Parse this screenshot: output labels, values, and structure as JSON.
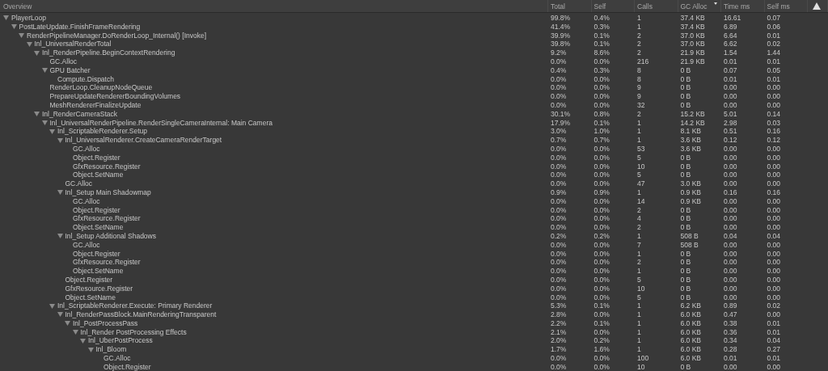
{
  "columns": [
    {
      "label": "Overview"
    },
    {
      "label": "Total"
    },
    {
      "label": "Self"
    },
    {
      "label": "Calls"
    },
    {
      "label": "GC Alloc",
      "sorted": true
    },
    {
      "label": "Time ms"
    },
    {
      "label": "Self ms"
    }
  ],
  "rows": [
    {
      "name": "PlayerLoop",
      "expanded": true,
      "cells": [
        "99.8%",
        "0.4%",
        "1",
        "37.4 KB",
        "16.61",
        "0.07"
      ],
      "children": [
        {
          "name": "PostLateUpdate.FinishFrameRendering",
          "expanded": true,
          "cells": [
            "41.4%",
            "0.3%",
            "1",
            "37.4 KB",
            "6.89",
            "0.06"
          ],
          "children": [
            {
              "name": "RenderPipelineManager.DoRenderLoop_Internal() [Invoke]",
              "expanded": true,
              "cells": [
                "39.9%",
                "0.1%",
                "2",
                "37.0 KB",
                "6.64",
                "0.01"
              ],
              "children": [
                {
                  "name": "Inl_UniversalRenderTotal",
                  "expanded": true,
                  "cells": [
                    "39.8%",
                    "0.1%",
                    "2",
                    "37.0 KB",
                    "6.62",
                    "0.02"
                  ],
                  "children": [
                    {
                      "name": "Inl_RenderPipeline.BeginContextRendering",
                      "expanded": true,
                      "cells": [
                        "9.2%",
                        "8.6%",
                        "2",
                        "21.9 KB",
                        "1.54",
                        "1.44"
                      ],
                      "children": [
                        {
                          "name": "GC.Alloc",
                          "cells": [
                            "0.0%",
                            "0.0%",
                            "216",
                            "21.9 KB",
                            "0.01",
                            "0.01"
                          ]
                        },
                        {
                          "name": "GPU Batcher",
                          "expanded": true,
                          "cells": [
                            "0.4%",
                            "0.3%",
                            "8",
                            "0 B",
                            "0.07",
                            "0.05"
                          ],
                          "children": [
                            {
                              "name": "Compute.Dispatch",
                              "cells": [
                                "0.0%",
                                "0.0%",
                                "8",
                                "0 B",
                                "0.01",
                                "0.01"
                              ]
                            }
                          ]
                        },
                        {
                          "name": "RenderLoop.CleanupNodeQueue",
                          "cells": [
                            "0.0%",
                            "0.0%",
                            "9",
                            "0 B",
                            "0.00",
                            "0.00"
                          ]
                        },
                        {
                          "name": "PrepareUpdateRendererBoundingVolumes",
                          "cells": [
                            "0.0%",
                            "0.0%",
                            "9",
                            "0 B",
                            "0.00",
                            "0.00"
                          ]
                        },
                        {
                          "name": "MeshRendererFinalizeUpdate",
                          "cells": [
                            "0.0%",
                            "0.0%",
                            "32",
                            "0 B",
                            "0.00",
                            "0.00"
                          ]
                        }
                      ]
                    },
                    {
                      "name": "Inl_RenderCameraStack",
                      "expanded": true,
                      "cells": [
                        "30.1%",
                        "0.8%",
                        "2",
                        "15.2 KB",
                        "5.01",
                        "0.14"
                      ],
                      "children": [
                        {
                          "name": "Inl_UniversalRenderPipeline.RenderSingleCameraInternal: Main Camera",
                          "expanded": true,
                          "cells": [
                            "17.9%",
                            "0.1%",
                            "1",
                            "14.2 KB",
                            "2.98",
                            "0.03"
                          ],
                          "children": [
                            {
                              "name": "Inl_ScriptableRenderer.Setup",
                              "expanded": true,
                              "cells": [
                                "3.0%",
                                "1.0%",
                                "1",
                                "8.1 KB",
                                "0.51",
                                "0.16"
                              ],
                              "children": [
                                {
                                  "name": "Inl_UniversalRenderer.CreateCameraRenderTarget",
                                  "expanded": true,
                                  "cells": [
                                    "0.7%",
                                    "0.7%",
                                    "1",
                                    "3.6 KB",
                                    "0.12",
                                    "0.12"
                                  ],
                                  "children": [
                                    {
                                      "name": "GC.Alloc",
                                      "cells": [
                                        "0.0%",
                                        "0.0%",
                                        "53",
                                        "3.6 KB",
                                        "0.00",
                                        "0.00"
                                      ]
                                    },
                                    {
                                      "name": "Object.Register",
                                      "cells": [
                                        "0.0%",
                                        "0.0%",
                                        "5",
                                        "0 B",
                                        "0.00",
                                        "0.00"
                                      ]
                                    },
                                    {
                                      "name": "GfxResource.Register",
                                      "cells": [
                                        "0.0%",
                                        "0.0%",
                                        "10",
                                        "0 B",
                                        "0.00",
                                        "0.00"
                                      ]
                                    },
                                    {
                                      "name": "Object.SetName",
                                      "cells": [
                                        "0.0%",
                                        "0.0%",
                                        "5",
                                        "0 B",
                                        "0.00",
                                        "0.00"
                                      ]
                                    }
                                  ]
                                },
                                {
                                  "name": "GC.Alloc",
                                  "cells": [
                                    "0.0%",
                                    "0.0%",
                                    "47",
                                    "3.0 KB",
                                    "0.00",
                                    "0.00"
                                  ]
                                },
                                {
                                  "name": "Inl_Setup Main Shadowmap",
                                  "expanded": true,
                                  "cells": [
                                    "0.9%",
                                    "0.9%",
                                    "1",
                                    "0.9 KB",
                                    "0.16",
                                    "0.16"
                                  ],
                                  "children": [
                                    {
                                      "name": "GC.Alloc",
                                      "cells": [
                                        "0.0%",
                                        "0.0%",
                                        "14",
                                        "0.9 KB",
                                        "0.00",
                                        "0.00"
                                      ]
                                    },
                                    {
                                      "name": "Object.Register",
                                      "cells": [
                                        "0.0%",
                                        "0.0%",
                                        "2",
                                        "0 B",
                                        "0.00",
                                        "0.00"
                                      ]
                                    },
                                    {
                                      "name": "GfxResource.Register",
                                      "cells": [
                                        "0.0%",
                                        "0.0%",
                                        "4",
                                        "0 B",
                                        "0.00",
                                        "0.00"
                                      ]
                                    },
                                    {
                                      "name": "Object.SetName",
                                      "cells": [
                                        "0.0%",
                                        "0.0%",
                                        "2",
                                        "0 B",
                                        "0.00",
                                        "0.00"
                                      ]
                                    }
                                  ]
                                },
                                {
                                  "name": "Inl_Setup Additional Shadows",
                                  "expanded": true,
                                  "cells": [
                                    "0.2%",
                                    "0.2%",
                                    "1",
                                    "508 B",
                                    "0.04",
                                    "0.04"
                                  ],
                                  "children": [
                                    {
                                      "name": "GC.Alloc",
                                      "cells": [
                                        "0.0%",
                                        "0.0%",
                                        "7",
                                        "508 B",
                                        "0.00",
                                        "0.00"
                                      ]
                                    },
                                    {
                                      "name": "Object.Register",
                                      "cells": [
                                        "0.0%",
                                        "0.0%",
                                        "1",
                                        "0 B",
                                        "0.00",
                                        "0.00"
                                      ]
                                    },
                                    {
                                      "name": "GfxResource.Register",
                                      "cells": [
                                        "0.0%",
                                        "0.0%",
                                        "2",
                                        "0 B",
                                        "0.00",
                                        "0.00"
                                      ]
                                    },
                                    {
                                      "name": "Object.SetName",
                                      "cells": [
                                        "0.0%",
                                        "0.0%",
                                        "1",
                                        "0 B",
                                        "0.00",
                                        "0.00"
                                      ]
                                    }
                                  ]
                                },
                                {
                                  "name": "Object.Register",
                                  "cells": [
                                    "0.0%",
                                    "0.0%",
                                    "5",
                                    "0 B",
                                    "0.00",
                                    "0.00"
                                  ]
                                },
                                {
                                  "name": "GfxResource.Register",
                                  "cells": [
                                    "0.0%",
                                    "0.0%",
                                    "10",
                                    "0 B",
                                    "0.00",
                                    "0.00"
                                  ]
                                },
                                {
                                  "name": "Object.SetName",
                                  "cells": [
                                    "0.0%",
                                    "0.0%",
                                    "5",
                                    "0 B",
                                    "0.00",
                                    "0.00"
                                  ]
                                }
                              ]
                            },
                            {
                              "name": "Inl_ScriptableRenderer.Execute: Primary Renderer",
                              "expanded": true,
                              "cells": [
                                "5.3%",
                                "0.1%",
                                "1",
                                "6.2 KB",
                                "0.89",
                                "0.02"
                              ],
                              "children": [
                                {
                                  "name": "Inl_RenderPassBlock.MainRenderingTransparent",
                                  "expanded": true,
                                  "cells": [
                                    "2.8%",
                                    "0.0%",
                                    "1",
                                    "6.0 KB",
                                    "0.47",
                                    "0.00"
                                  ],
                                  "children": [
                                    {
                                      "name": "Inl_PostProcessPass",
                                      "expanded": true,
                                      "cells": [
                                        "2.2%",
                                        "0.1%",
                                        "1",
                                        "6.0 KB",
                                        "0.38",
                                        "0.01"
                                      ],
                                      "children": [
                                        {
                                          "name": "Inl_Render PostProcessing Effects",
                                          "expanded": true,
                                          "cells": [
                                            "2.1%",
                                            "0.0%",
                                            "1",
                                            "6.0 KB",
                                            "0.36",
                                            "0.01"
                                          ],
                                          "children": [
                                            {
                                              "name": "Inl_UberPostProcess",
                                              "expanded": true,
                                              "cells": [
                                                "2.0%",
                                                "0.2%",
                                                "1",
                                                "6.0 KB",
                                                "0.34",
                                                "0.04"
                                              ],
                                              "children": [
                                                {
                                                  "name": "Inl_Bloom",
                                                  "expanded": true,
                                                  "cells": [
                                                    "1.7%",
                                                    "1.6%",
                                                    "1",
                                                    "6.0 KB",
                                                    "0.28",
                                                    "0.27"
                                                  ],
                                                  "children": [
                                                    {
                                                      "name": "GC.Alloc",
                                                      "cells": [
                                                        "0.0%",
                                                        "0.0%",
                                                        "100",
                                                        "6.0 KB",
                                                        "0.01",
                                                        "0.01"
                                                      ]
                                                    },
                                                    {
                                                      "name": "Object.Register",
                                                      "cells": [
                                                        "0.0%",
                                                        "0.0%",
                                                        "10",
                                                        "0 B",
                                                        "0.00",
                                                        "0.00"
                                                      ]
                                                    }
                                                  ]
                                                }
                                              ]
                                            }
                                          ]
                                        }
                                      ]
                                    }
                                  ]
                                }
                              ]
                            }
                          ]
                        }
                      ]
                    }
                  ]
                }
              ]
            }
          ]
        }
      ]
    }
  ]
}
